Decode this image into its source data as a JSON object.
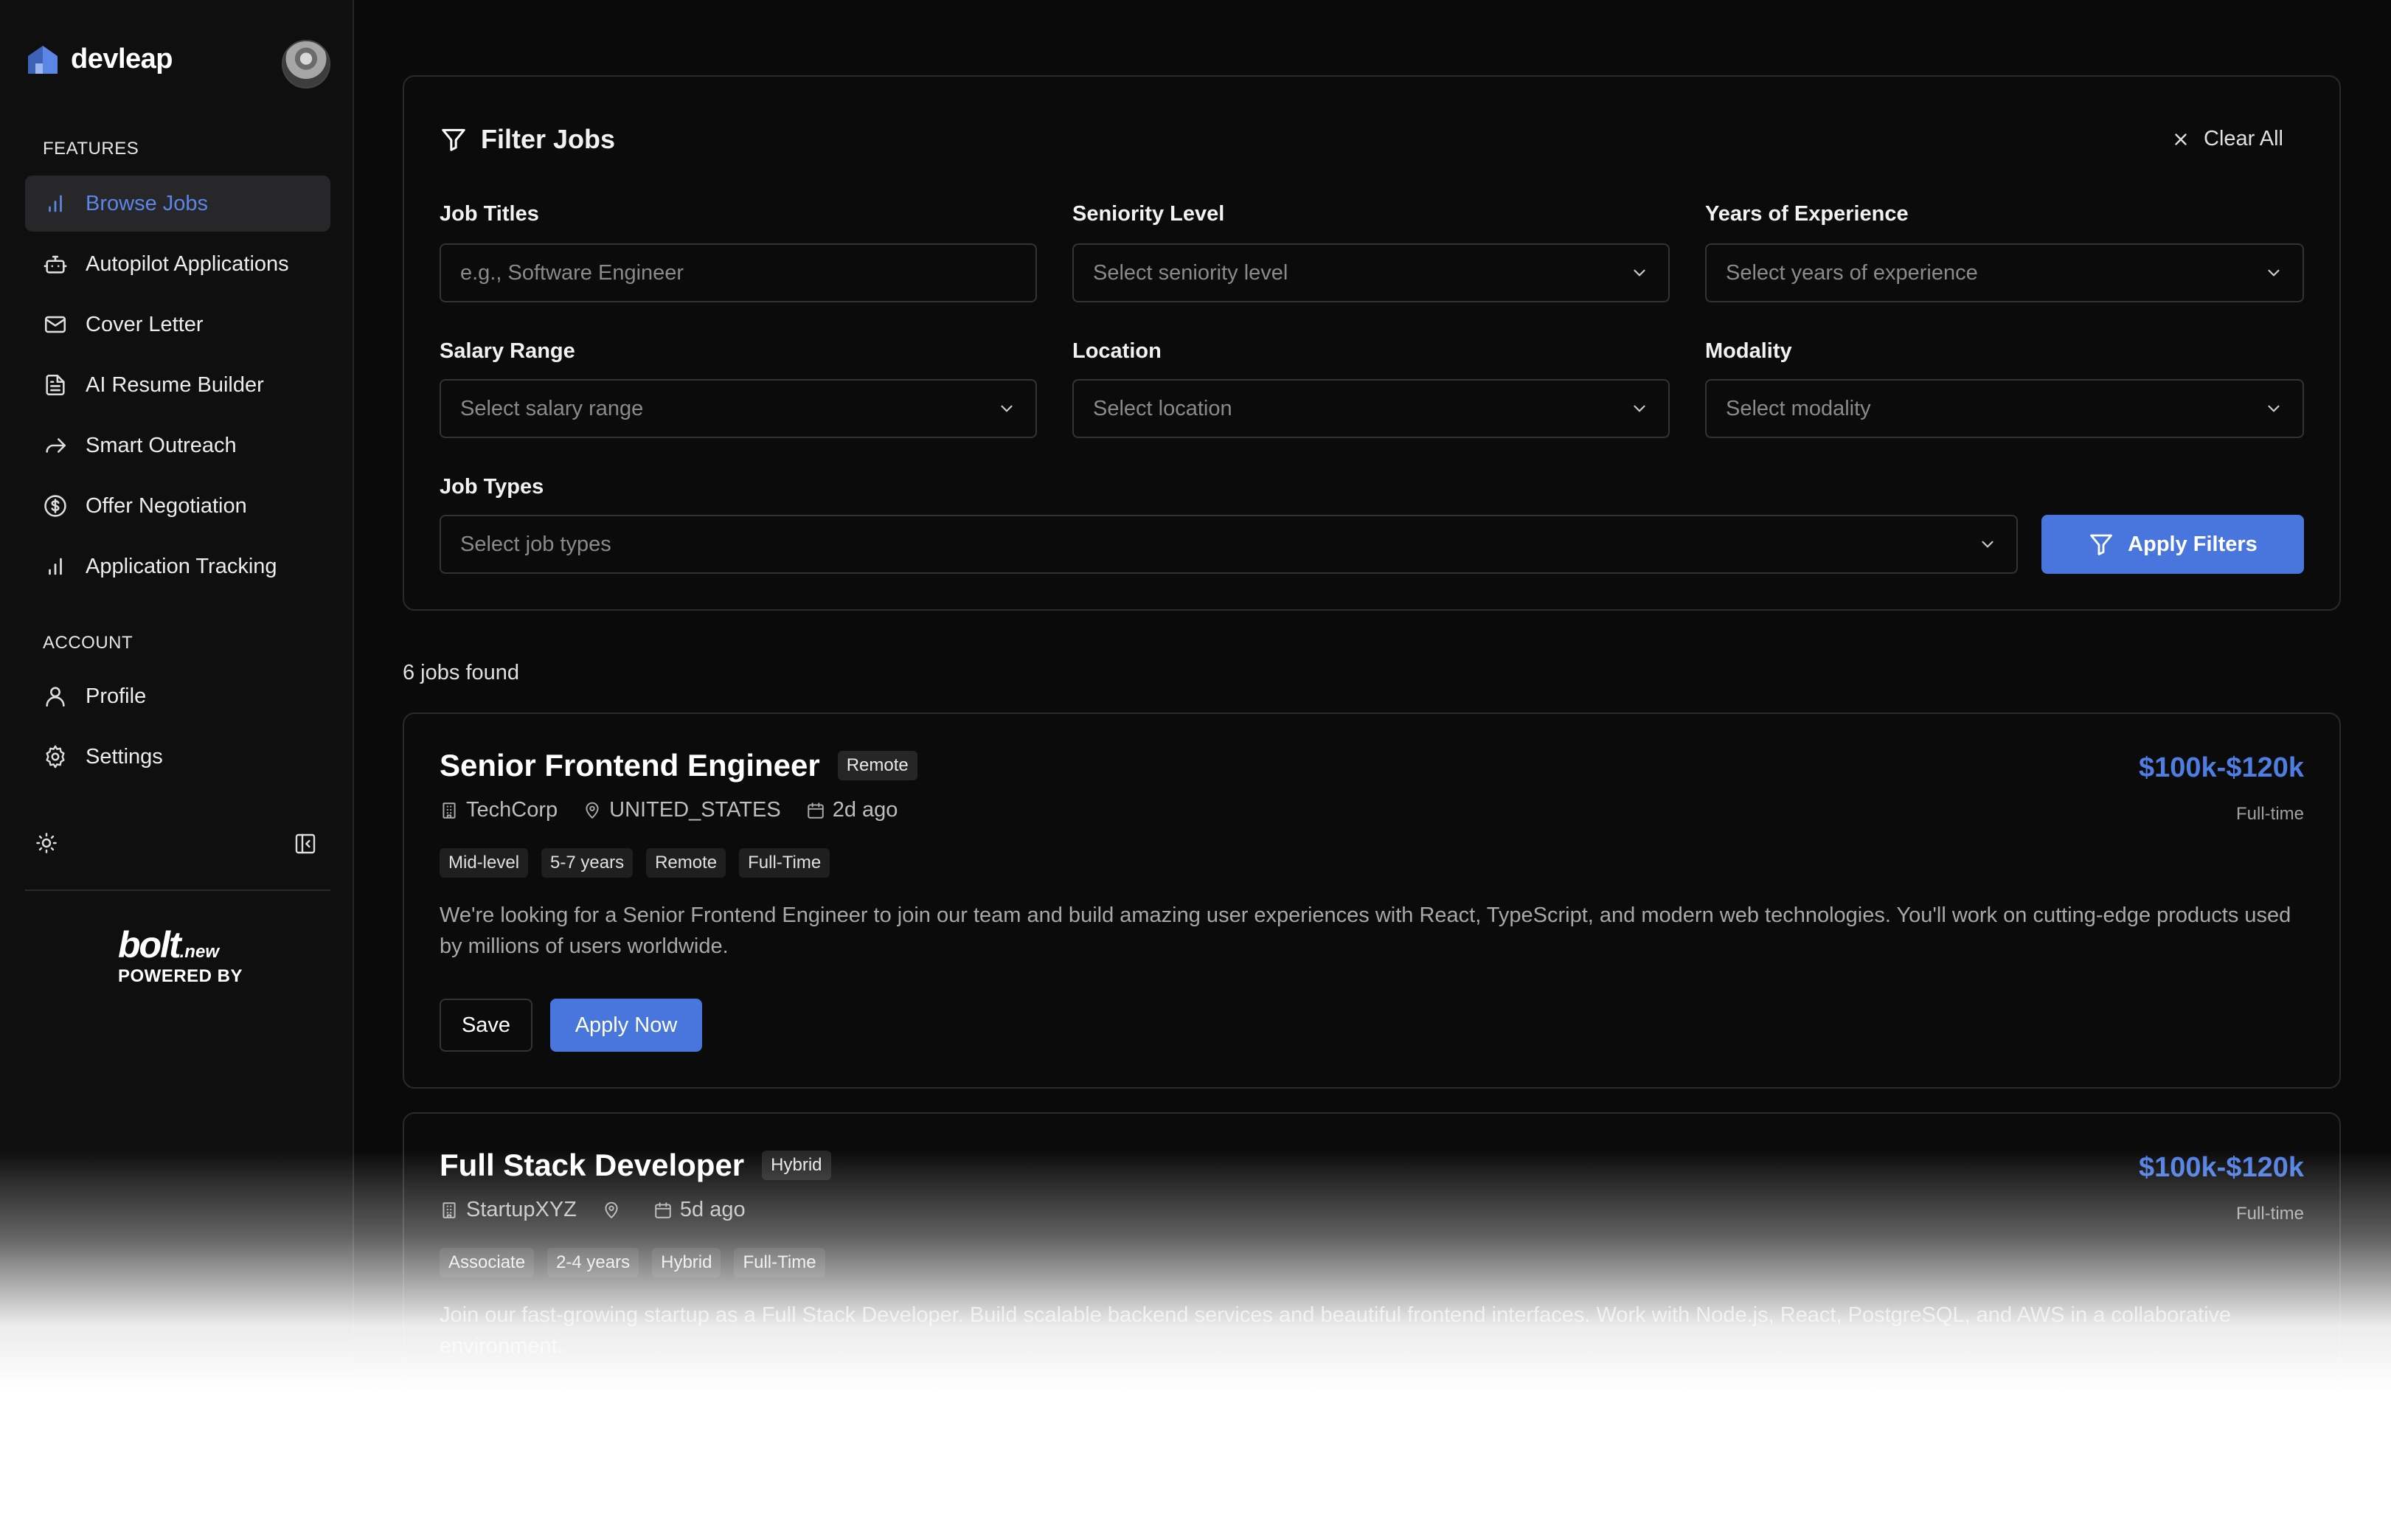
{
  "brand": {
    "name": "devleap"
  },
  "sidebar": {
    "features_title": "FEATURES",
    "account_title": "ACCOUNT",
    "features": [
      {
        "label": "Browse Jobs",
        "icon": "bar-chart-icon",
        "active": true
      },
      {
        "label": "Autopilot Applications",
        "icon": "bot-icon"
      },
      {
        "label": "Cover Letter",
        "icon": "mail-icon"
      },
      {
        "label": "AI Resume Builder",
        "icon": "file-text-icon"
      },
      {
        "label": "Smart Outreach",
        "icon": "forward-arrow-icon"
      },
      {
        "label": "Offer Negotiation",
        "icon": "dollar-circle-icon"
      },
      {
        "label": "Application Tracking",
        "icon": "bar-chart-icon"
      }
    ],
    "account": [
      {
        "label": "Profile",
        "icon": "user-icon"
      },
      {
        "label": "Settings",
        "icon": "gear-icon"
      }
    ],
    "footer": {
      "logo": "bolt",
      "logo_suffix": ".new",
      "powered_by": "POWERED BY"
    }
  },
  "filters": {
    "title": "Filter Jobs",
    "clear_all": "Clear All",
    "job_titles": {
      "label": "Job Titles",
      "placeholder": "e.g., Software Engineer"
    },
    "seniority": {
      "label": "Seniority Level",
      "placeholder": "Select seniority level"
    },
    "experience": {
      "label": "Years of Experience",
      "placeholder": "Select years of experience"
    },
    "salary": {
      "label": "Salary Range",
      "placeholder": "Select salary range"
    },
    "location": {
      "label": "Location",
      "placeholder": "Select location"
    },
    "modality": {
      "label": "Modality",
      "placeholder": "Select modality"
    },
    "job_types": {
      "label": "Job Types",
      "placeholder": "Select job types"
    },
    "apply_label": "Apply Filters"
  },
  "results": {
    "count_text": "6 jobs found"
  },
  "jobs": [
    {
      "title": "Senior Frontend Engineer",
      "badge": "Remote",
      "company": "TechCorp",
      "location": "UNITED_STATES",
      "posted": "2d ago",
      "tags": [
        "Mid-level",
        "5-7 years",
        "Remote",
        "Full-Time"
      ],
      "description": "We're looking for a Senior Frontend Engineer to join our team and build amazing user experiences with React, TypeScript, and modern web technologies. You'll work on cutting-edge products used by millions of users worldwide.",
      "salary": "$100k-$120k",
      "type": "Full-time",
      "save_label": "Save",
      "apply_label": "Apply Now"
    },
    {
      "title": "Full Stack Developer",
      "badge": "Hybrid",
      "company": "StartupXYZ",
      "location": "",
      "posted": "5d ago",
      "tags": [
        "Associate",
        "2-4 years",
        "Hybrid",
        "Full-Time"
      ],
      "description": "Join our fast-growing startup as a Full Stack Developer. Build scalable backend services and beautiful frontend interfaces. Work with Node.js, React, PostgreSQL, and AWS in a collaborative environment.",
      "salary": "$100k-$120k",
      "type": "Full-time"
    }
  ],
  "colors": {
    "accent": "#4876dd",
    "salary": "#4f7ee3",
    "background": "#0a0a0a"
  }
}
